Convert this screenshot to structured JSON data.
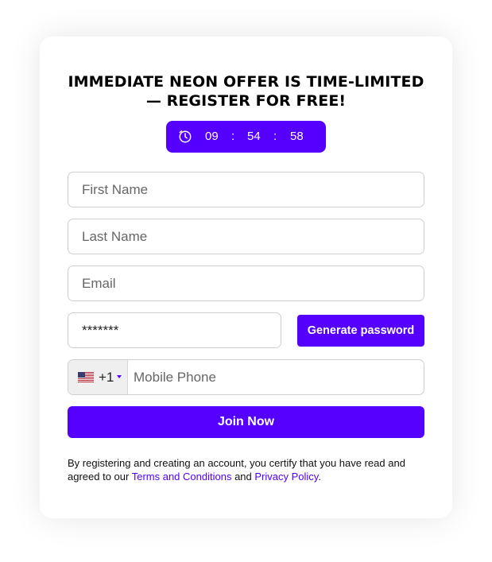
{
  "headline": "IMMEDIATE NEON OFFER IS TIME-LIMITED — REGISTER FOR FREE!",
  "timer": {
    "hours": "09",
    "minutes": "54",
    "seconds": "58",
    "separator": ":",
    "icon": "clock-icon"
  },
  "form": {
    "first_name_placeholder": "First Name",
    "last_name_placeholder": "Last Name",
    "email_placeholder": "Email",
    "password_value": "*******",
    "generate_password_label": "Generate password",
    "country_flag": "us-flag-icon",
    "dial_code": "+1",
    "phone_placeholder": "Mobile Phone",
    "join_label": "Join Now"
  },
  "legal": {
    "text_before": "By registering and creating an account, you certify that you have read and agreed to our ",
    "terms_link": "Terms and Conditions",
    "text_and": " and ",
    "privacy_link": "Privacy Policy",
    "text_end": "."
  },
  "colors": {
    "accent": "#5500ff",
    "border": "#cfcfcf",
    "country_bg": "#efefef"
  }
}
